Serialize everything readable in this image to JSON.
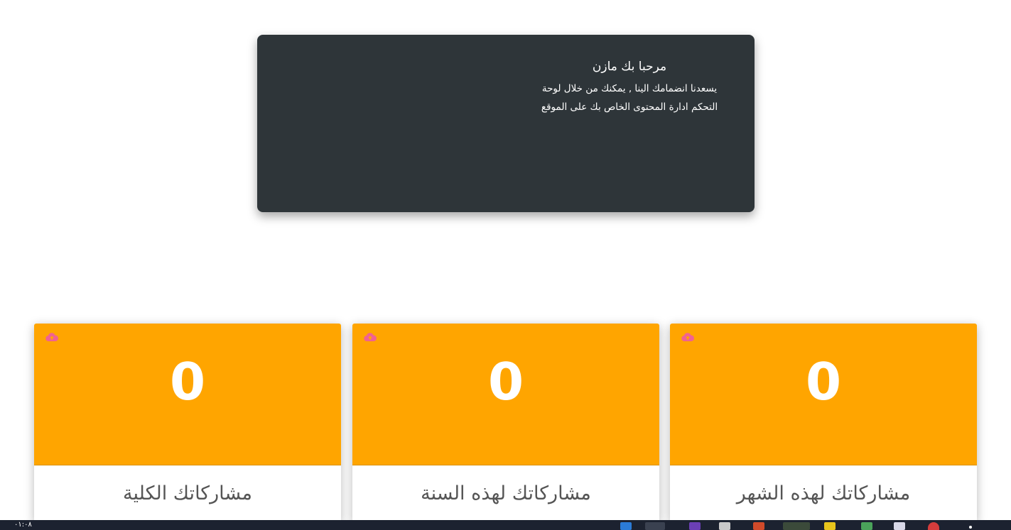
{
  "welcome": {
    "title": "مرحبا بك مازن",
    "message": "يسعدنا  انضمامك الينا , يمكنك من خلال لوحة التحكم ادارة المحتوى الخاص بك على الموقع"
  },
  "stats": [
    {
      "label": "مشاركاتك الكلية",
      "value": "0",
      "icon": "cloud-upload-icon"
    },
    {
      "label": "مشاركاتك لهذه السنة",
      "value": "0",
      "icon": "cloud-upload-icon"
    },
    {
      "label": "مشاركاتك لهذه الشهر",
      "value": "0",
      "icon": "cloud-upload-icon"
    }
  ],
  "taskbar": {
    "clock": "٠١:٠٨"
  },
  "colors": {
    "card_accent": "#ffa500",
    "welcome_bg": "#2e3539",
    "icon_color": "#f06292"
  }
}
